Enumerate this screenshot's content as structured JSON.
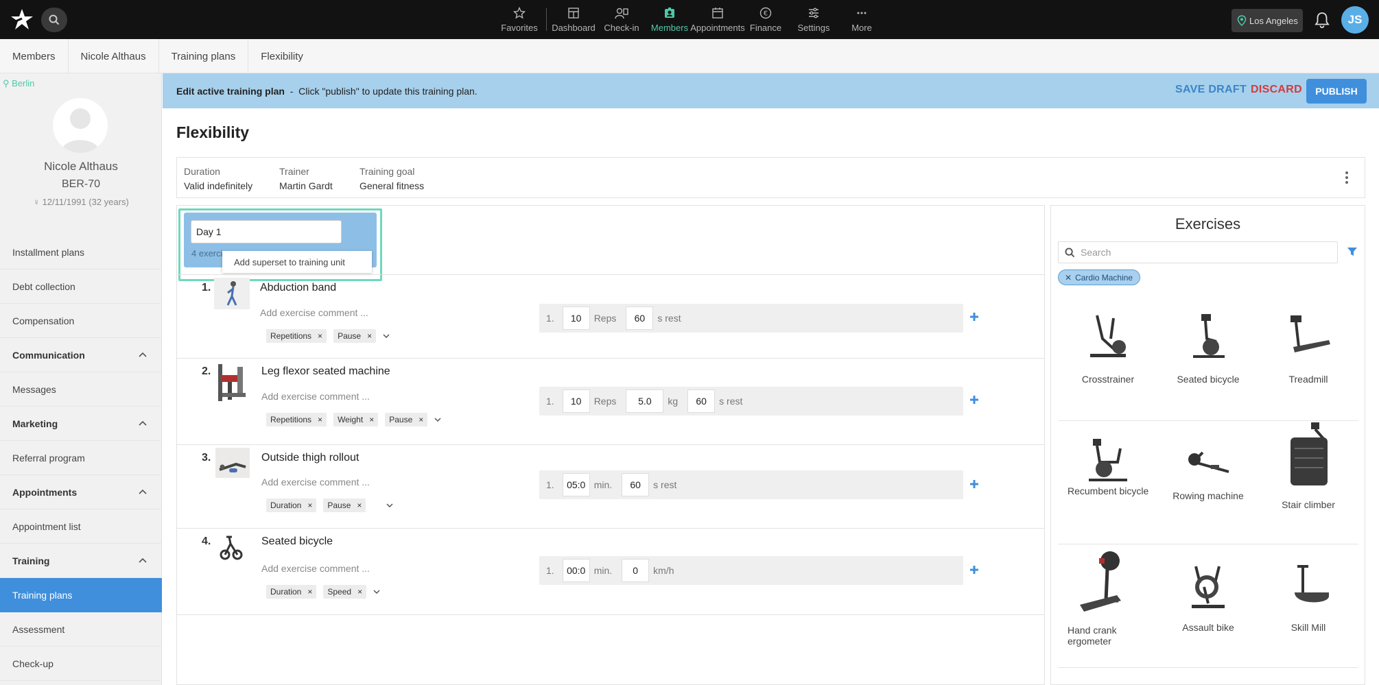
{
  "topbar": {
    "nav": [
      {
        "label": "Favorites",
        "icon": "star-icon"
      },
      {
        "label": "Dashboard",
        "icon": "dashboard-icon"
      },
      {
        "label": "Check-in",
        "icon": "check-in-icon"
      },
      {
        "label": "Members",
        "icon": "members-icon"
      },
      {
        "label": "Appointments",
        "icon": "calendar-icon"
      },
      {
        "label": "Finance",
        "icon": "euro-icon"
      },
      {
        "label": "Settings",
        "icon": "sliders-icon"
      },
      {
        "label": "More",
        "icon": "more-icon"
      }
    ],
    "active_nav": "Members",
    "location": "Los Angeles",
    "user_initials": "JS",
    "accent_color": "#4ec9a7"
  },
  "breadcrumb": [
    "Members",
    "Nicole Althaus",
    "Training plans",
    "Flexibility"
  ],
  "sidebar": {
    "branch": "Berlin",
    "name": "Nicole Althaus",
    "member_id": "BER-70",
    "dob": "12/11/1991 (32 years)",
    "items": [
      {
        "label": "Installment plans",
        "type": "item"
      },
      {
        "label": "Debt collection",
        "type": "item"
      },
      {
        "label": "Compensation",
        "type": "item"
      },
      {
        "label": "Communication",
        "type": "section"
      },
      {
        "label": "Messages",
        "type": "item"
      },
      {
        "label": "Marketing",
        "type": "section"
      },
      {
        "label": "Referral program",
        "type": "item"
      },
      {
        "label": "Appointments",
        "type": "section"
      },
      {
        "label": "Appointment list",
        "type": "item"
      },
      {
        "label": "Training",
        "type": "section"
      },
      {
        "label": "Training plans",
        "type": "active"
      },
      {
        "label": "Assessment",
        "type": "item"
      },
      {
        "label": "Check-up",
        "type": "item"
      }
    ]
  },
  "notice": {
    "title": "Edit active training plan",
    "separator": "-",
    "message": "Click \"publish\" to update this training plan.",
    "save_draft": "SAVE DRAFT",
    "discard": "DISCARD",
    "publish": "PUBLISH"
  },
  "plan": {
    "title": "Flexibility",
    "duration_label": "Duration",
    "duration_value": "Valid indefinitely",
    "trainer_label": "Trainer",
    "trainer_value": "Martin Gardt",
    "goal_label": "Training goal",
    "goal_value": "General fitness"
  },
  "day": {
    "name": "Day 1",
    "count": "4 exercises",
    "tooltip": "Add superset to training unit"
  },
  "exercise_placeholder": "Add exercise comment ...",
  "exercises": [
    {
      "num": "1.",
      "name": "Abduction band",
      "tags": [
        "Repetitions",
        "Pause"
      ],
      "set": {
        "idx": "1.",
        "v1": "10",
        "u1": "Reps",
        "v2": "60",
        "u2": "s rest"
      }
    },
    {
      "num": "2.",
      "name": "Leg flexor seated machine",
      "tags": [
        "Repetitions",
        "Weight",
        "Pause"
      ],
      "set": {
        "idx": "1.",
        "v1": "10",
        "u1": "Reps",
        "v2": "5.0",
        "u2": "kg",
        "v3": "60",
        "u3": "s rest"
      }
    },
    {
      "num": "3.",
      "name": "Outside thigh rollout",
      "tags": [
        "Duration",
        "Pause"
      ],
      "set": {
        "idx": "1.",
        "v1": "05:0",
        "u1": "min.",
        "v2": "60",
        "u2": "s rest"
      }
    },
    {
      "num": "4.",
      "name": "Seated bicycle",
      "tags": [
        "Duration",
        "Speed"
      ],
      "set": {
        "idx": "1.",
        "v1": "00:0",
        "u1": "min.",
        "v2": "0",
        "u2": "km/h"
      }
    }
  ],
  "library": {
    "title": "Exercises",
    "search_placeholder": "Search",
    "filter_chip": "Cardio Machine",
    "items": [
      "Crosstrainer",
      "Seated bicycle",
      "Treadmill",
      "Recumbent bicycle",
      "Rowing machine",
      "Stair climber",
      "Hand crank ergometer",
      "Assault bike",
      "Skill Mill"
    ]
  }
}
